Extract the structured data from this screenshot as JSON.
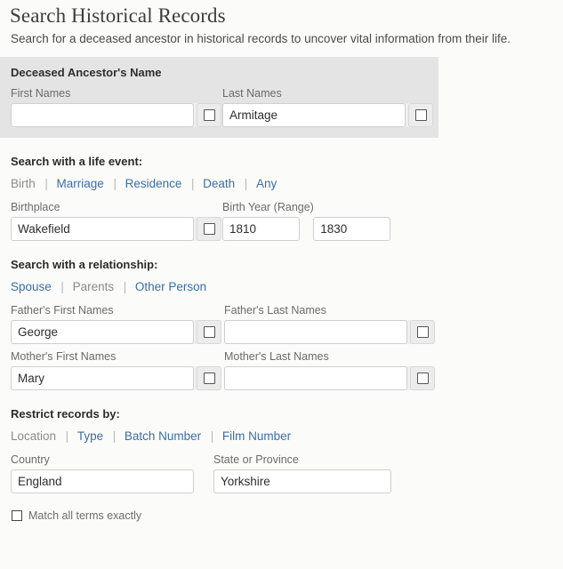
{
  "header": {
    "title": "Search Historical Records",
    "subtitle": "Search for a deceased ancestor in historical records to uncover vital information from their life."
  },
  "name_panel": {
    "heading": "Deceased Ancestor's Name",
    "first_names": {
      "label": "First Names",
      "value": "",
      "placeholder": "",
      "exact_checkbox": false
    },
    "last_names": {
      "label": "Last Names",
      "value": "Armitage",
      "placeholder": "",
      "exact_checkbox": false
    }
  },
  "life_event": {
    "heading": "Search with a life event:",
    "tabs": [
      {
        "label": "Birth",
        "active": true
      },
      {
        "label": "Marriage",
        "active": false
      },
      {
        "label": "Residence",
        "active": false
      },
      {
        "label": "Death",
        "active": false
      },
      {
        "label": "Any",
        "active": false
      }
    ],
    "separator": "|",
    "birthplace": {
      "label": "Birthplace",
      "value": "Wakefield",
      "placeholder": "",
      "exact_checkbox": false
    },
    "birth_year": {
      "label": "Birth Year (Range)",
      "from": "1810",
      "to": "1830"
    }
  },
  "relationship": {
    "heading": "Search with a relationship:",
    "tabs": [
      {
        "label": "Spouse",
        "active": false
      },
      {
        "label": "Parents",
        "active": true
      },
      {
        "label": "Other Person",
        "active": false
      }
    ],
    "separator": "|",
    "fathers_first_names": {
      "label": "Father's First Names",
      "value": "George",
      "placeholder": "",
      "exact_checkbox": false
    },
    "fathers_last_names": {
      "label": "Father's Last Names",
      "value": "",
      "placeholder": "",
      "exact_checkbox": false
    },
    "mothers_first_names": {
      "label": "Mother's First Names",
      "value": "Mary",
      "placeholder": "",
      "exact_checkbox": false
    },
    "mothers_last_names": {
      "label": "Mother's Last Names",
      "value": "",
      "placeholder": "",
      "exact_checkbox": false
    }
  },
  "restrict": {
    "heading": "Restrict records by:",
    "tabs": [
      {
        "label": "Location",
        "active": true
      },
      {
        "label": "Type",
        "active": false
      },
      {
        "label": "Batch Number",
        "active": false
      },
      {
        "label": "Film Number",
        "active": false
      }
    ],
    "separator": "|",
    "country": {
      "label": "Country",
      "value": "England",
      "placeholder": ""
    },
    "state_or_province": {
      "label": "State or Province",
      "value": "Yorkshire",
      "placeholder": ""
    }
  },
  "match_all": {
    "label": "Match all terms exactly",
    "checked": false
  },
  "colors": {
    "link": "#3a6ea5",
    "active_tab": "#8a8a8a",
    "panel_bg": "#e4e4e4",
    "page_bg": "#fbfbfa",
    "label": "#6b6b6b"
  }
}
